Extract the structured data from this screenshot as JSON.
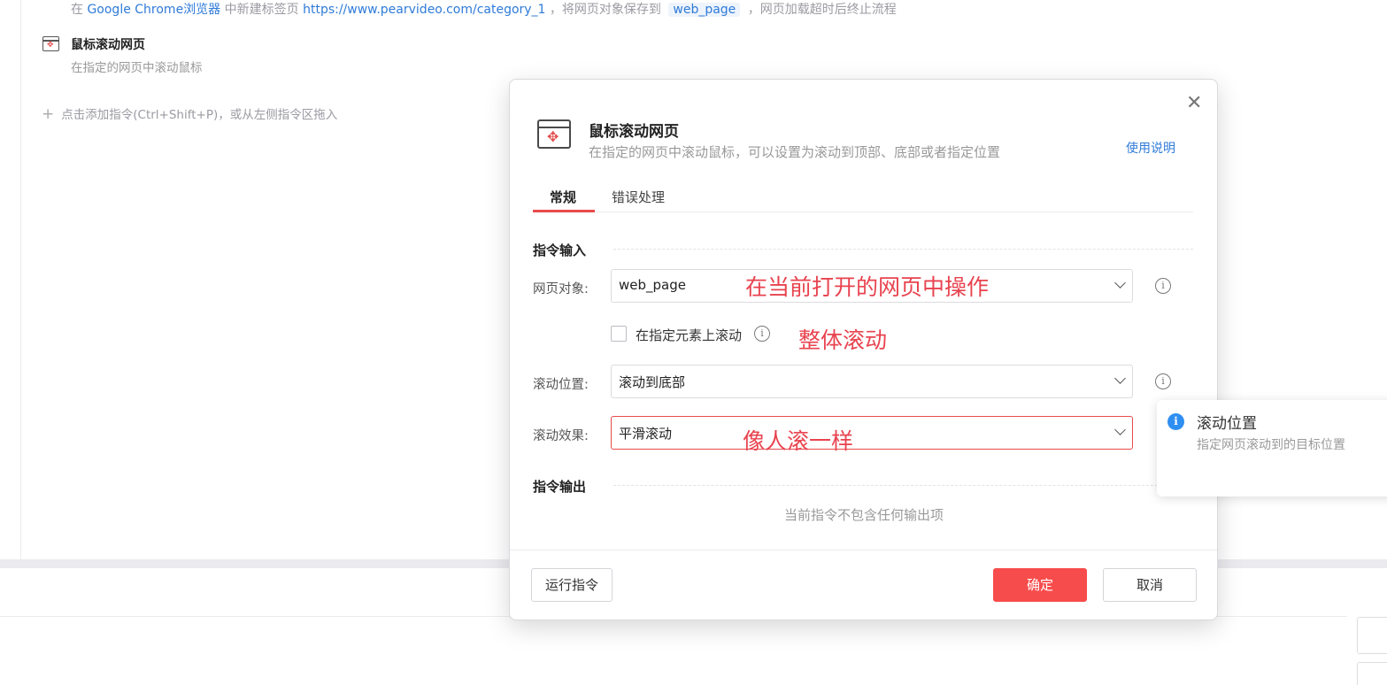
{
  "background": {
    "step1": {
      "prefix": "在",
      "browser": "Google Chrome浏览器",
      "mid1": "中新建标签页",
      "url": "https://www.pearvideo.com/category_1",
      "mid2": "，将网页对象保存到",
      "var": "web_page",
      "suffix": "，网页加载超时后终止流程"
    },
    "step2": {
      "title": "鼠标滚动网页",
      "desc": "在指定的网页中滚动鼠标"
    },
    "add_hint": "点击添加指令(Ctrl+Shift+P)，或从左侧指令区拖入"
  },
  "dialog": {
    "title": "鼠标滚动网页",
    "desc": "在指定的网页中滚动鼠标，可以设置为滚动到顶部、底部或者指定位置",
    "help_link": "使用说明",
    "tabs": [
      {
        "label": "常规",
        "active": true
      },
      {
        "label": "错误处理",
        "active": false
      }
    ],
    "input_section": "指令输入",
    "fields": {
      "web_object": {
        "label": "网页对象:",
        "value": "web_page"
      },
      "scroll_on_element": {
        "label": "在指定元素上滚动",
        "checked": false
      },
      "scroll_position": {
        "label": "滚动位置:",
        "value": "滚动到底部"
      },
      "scroll_effect": {
        "label": "滚动效果:",
        "value": "平滑滚动"
      }
    },
    "output_section": "指令输出",
    "output_empty": "当前指令不包含任何输出项",
    "buttons": {
      "run": "运行指令",
      "ok": "确定",
      "cancel": "取消"
    }
  },
  "annotations": {
    "web_object_note": "在当前打开的网页中操作",
    "checkbox_note": "整体滚动",
    "effect_note": "像人滚一样"
  },
  "tooltip": {
    "title": "滚动位置",
    "desc": "指定网页滚动到的目标位置"
  },
  "colors": {
    "accent": "#f74c4c",
    "link": "#2f7bd8",
    "annotation": "#e8434f",
    "info": "#2f8ff0"
  }
}
